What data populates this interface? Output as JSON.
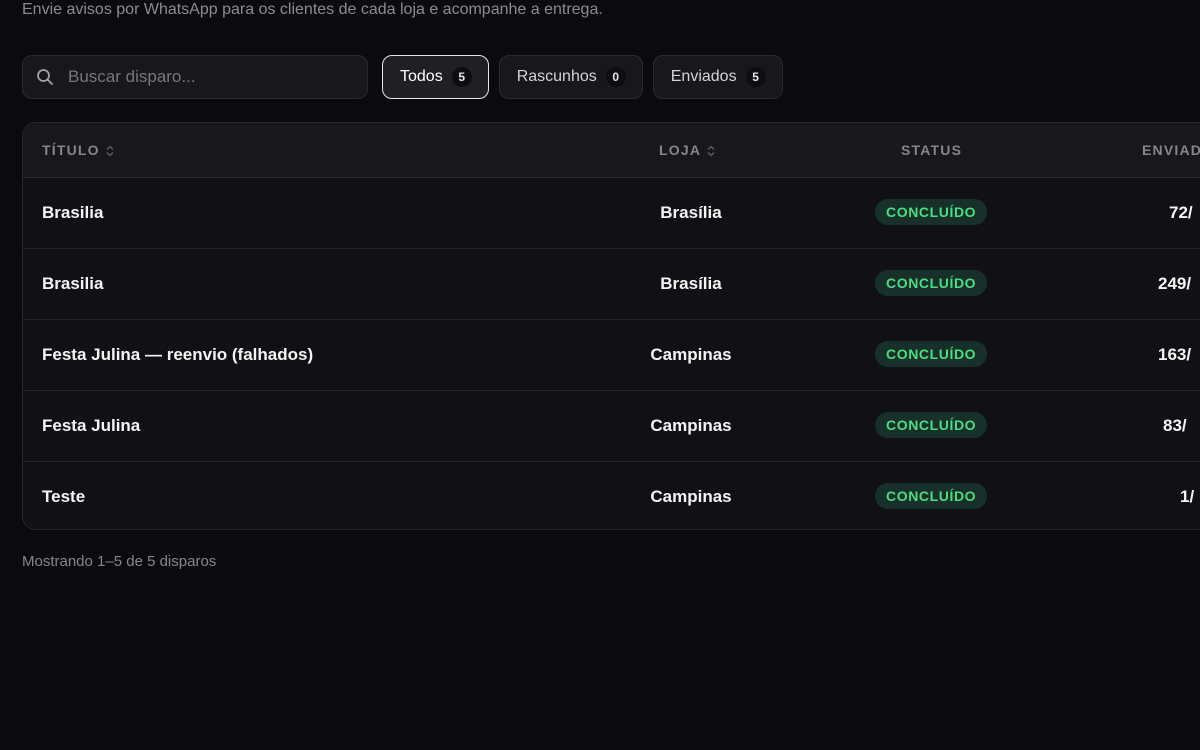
{
  "header": {
    "subtitle": "Envie avisos por WhatsApp para os clientes de cada loja e acompanhe a entrega."
  },
  "search": {
    "placeholder": "Buscar disparo...",
    "value": ""
  },
  "filters": [
    {
      "label": "Todos",
      "count": "5",
      "active": true
    },
    {
      "label": "Rascunhos",
      "count": "0",
      "active": false
    },
    {
      "label": "Enviados",
      "count": "5",
      "active": false
    }
  ],
  "table": {
    "columns": {
      "title": "TÍTULO",
      "store": "LOJA",
      "status": "STATUS",
      "sent": "ENVIAD"
    },
    "rows": [
      {
        "title": "Brasilia",
        "store": "Brasília",
        "status": "CONCLUÍDO",
        "sent": "72/"
      },
      {
        "title": "Brasilia",
        "store": "Brasília",
        "status": "CONCLUÍDO",
        "sent": "249/"
      },
      {
        "title": "Festa Julina — reenvio (falhados)",
        "store": "Campinas",
        "status": "CONCLUÍDO",
        "sent": "163/"
      },
      {
        "title": "Festa Julina",
        "store": "Campinas",
        "status": "CONCLUÍDO",
        "sent": "83/"
      },
      {
        "title": "Teste",
        "store": "Campinas",
        "status": "CONCLUÍDO",
        "sent": "1/"
      }
    ]
  },
  "footer": {
    "summary": "Mostrando 1–5 de 5 disparos"
  },
  "icons": {
    "search": "search-icon",
    "sort": "sort-icon"
  },
  "colors": {
    "background": "#0b0b0d",
    "status_success_text": "#4ade80",
    "status_success_bg": "#17302a"
  }
}
